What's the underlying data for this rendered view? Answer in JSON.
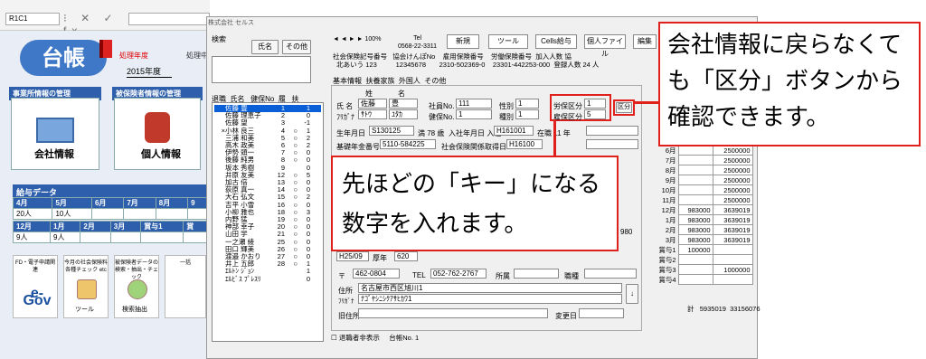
{
  "excel": {
    "cell_ref": "R1C1",
    "formula_symbols": "⁝ ✕ ✓ fx"
  },
  "left_menu": {
    "logo": "台帳",
    "processing_year_label": "処理年度",
    "year_value": "2015年度",
    "right_label": "処理中",
    "section_company": "事業所情報の管理",
    "section_insured": "被保険者情報の管理",
    "company_button": "会社情報",
    "person_button": "個人情報",
    "payroll_title": "給与データ",
    "payroll_row1_headers": [
      "4月",
      "5月",
      "6月",
      "7月",
      "8月",
      "9"
    ],
    "payroll_row1_values": [
      "20人",
      "10人",
      "",
      "",
      "",
      ""
    ],
    "payroll_row2_headers": [
      "12月",
      "1月",
      "2月",
      "3月",
      "賞与1",
      "賞"
    ],
    "payroll_row2_values": [
      "9人",
      "9人",
      "",
      "",
      "",
      ""
    ],
    "tool1_text": "FD・電子申請関連",
    "tool1_logo": "e-Gov",
    "tool2_text": "今月の社会保険料各種チェック etc",
    "tool2_label": "ツール",
    "tool3_text": "被保険者データの検索・抽出・チェック",
    "tool3_label": "検索抽出",
    "tool4_text": "一括"
  },
  "dialog": {
    "title": "株式会社 セルス",
    "search_label": "検索",
    "name_button": "氏名",
    "other_button": "その他",
    "list_header": [
      "退職",
      "氏名",
      "健保No",
      "履",
      "扶"
    ],
    "employees": [
      {
        "mark": "",
        "name": "佐藤 豊",
        "no": "1",
        "r": "",
        "f": "1",
        "sel": true
      },
      {
        "mark": "",
        "name": "佐藤 理恵子",
        "no": "2",
        "r": "",
        "f": "0",
        "sel": false
      },
      {
        "mark": "",
        "name": "佐藤 望",
        "no": "3",
        "r": "",
        "f": "-1",
        "sel": false
      },
      {
        "mark": "×",
        "name": "小林 良三",
        "no": "4",
        "r": "○",
        "f": "1",
        "sel": false
      },
      {
        "mark": "",
        "name": "三浦 和美",
        "no": "5",
        "r": "○",
        "f": "2",
        "sel": false
      },
      {
        "mark": "",
        "name": "高木 政美",
        "no": "6",
        "r": "○",
        "f": "2",
        "sel": false
      },
      {
        "mark": "",
        "name": "伊勢 頭一",
        "no": "7",
        "r": "○",
        "f": "0",
        "sel": false
      },
      {
        "mark": "",
        "name": "後藤 純男",
        "no": "8",
        "r": "○",
        "f": "0",
        "sel": false
      },
      {
        "mark": "",
        "name": "坂本 秀樹",
        "no": "9",
        "r": "",
        "f": "0",
        "sel": false
      },
      {
        "mark": "",
        "name": "井原 友美",
        "no": "12",
        "r": "○",
        "f": "5",
        "sel": false
      },
      {
        "mark": "",
        "name": "加古 倍",
        "no": "13",
        "r": "○",
        "f": "0",
        "sel": false
      },
      {
        "mark": "",
        "name": "荻原 真一",
        "no": "14",
        "r": "○",
        "f": "0",
        "sel": false
      },
      {
        "mark": "",
        "name": "大石 弘文",
        "no": "15",
        "r": "○",
        "f": "2",
        "sel": false
      },
      {
        "mark": "",
        "name": "吉平 小雪",
        "no": "16",
        "r": "○",
        "f": "0",
        "sel": false
      },
      {
        "mark": "",
        "name": "小柳 雅也",
        "no": "18",
        "r": "○",
        "f": "3",
        "sel": false
      },
      {
        "mark": "",
        "name": "内野 猛",
        "no": "19",
        "r": "○",
        "f": "0",
        "sel": false
      },
      {
        "mark": "",
        "name": "神部 幸子",
        "no": "20",
        "r": "○",
        "f": "0",
        "sel": false
      },
      {
        "mark": "",
        "name": "山田 学",
        "no": "21",
        "r": "○",
        "f": "0",
        "sel": false
      },
      {
        "mark": "",
        "name": "一之瀬 綾",
        "no": "25",
        "r": "○",
        "f": "0",
        "sel": false
      },
      {
        "mark": "",
        "name": "田口 輝美",
        "no": "26",
        "r": "○",
        "f": "0",
        "sel": false
      },
      {
        "mark": "",
        "name": "渡邉 かおり",
        "no": "27",
        "r": "○",
        "f": "0",
        "sel": false
      },
      {
        "mark": "",
        "name": "井上 五郎",
        "no": "28",
        "r": "○",
        "f": "1",
        "sel": false
      },
      {
        "mark": "",
        "name": "ｴﾙﾄﾝ ｼﾞｮﾝ",
        "no": "",
        "r": "",
        "f": "1",
        "sel": false
      },
      {
        "mark": "",
        "name": "ｴﾙﾋﾞｽ ﾌﾟﾚｽﾘ",
        "no": "",
        "r": "",
        "f": "0",
        "sel": false
      }
    ],
    "nav_arrows": "◄ ◄ ► ►",
    "zoom": "100%",
    "tel_label": "Tel",
    "tel_value": "0568-22-3311",
    "btn_new": "新規",
    "btn_tool": "ツール",
    "btn_cells": "Cells給与",
    "btn_personal_file": "個人ファイル",
    "btn_edit": "編集",
    "info_labels": [
      "社会保険記号番号",
      "協会けんぽNo",
      "雇用保険番号",
      "労働保険番号",
      "加入人数",
      "協"
    ],
    "info_values": [
      "北あいう 123",
      "12345678",
      "2310-502369-0",
      "23301-442253-000",
      "登録人数 24 人"
    ],
    "tabs": [
      "基本情報",
      "扶養家族",
      "外国人",
      "その他"
    ],
    "furi_header": [
      "姓",
      "名"
    ],
    "name_label": "氏 名",
    "last_name": "佐藤",
    "first_name": "豊",
    "kana_label": "ﾌﾘｶﾞﾅ",
    "last_kana": "ｻﾄｳ",
    "first_kana": "ﾕﾀｶ",
    "emp_no_label": "社員No.",
    "emp_no": "111",
    "health_no_label": "健保No.",
    "health_no": "1",
    "gender_label": "性別",
    "gender": "1",
    "type_label": "種別",
    "type": "1",
    "labor_kubun_label": "労保区分",
    "labor_kubun": "1",
    "emp_kubun_label": "雇保区分",
    "emp_kubun": "5",
    "kubun_button": "区分",
    "birth_label": "生年月日",
    "birth_value": "S130125",
    "age_value": "満 78 歳",
    "join_label": "入社年月日 入社",
    "join_value": "H161001",
    "tenure": "在職 11 年",
    "pension_label": "基礎年金番号",
    "pension_value": "5110-584225",
    "social_rel_label": "社会保険関係",
    "acquire_label": "取得日",
    "acquire_value": "H16100",
    "grade_label": "H25/09",
    "grade_mid": "厚年",
    "grade_val": "620",
    "extra_val": "980",
    "zip_label": "〒",
    "zip_value": "462-0804",
    "tel2_label": "TEL",
    "tel2_value": "052-762-2767",
    "dept_label": "所属",
    "job_label": "職種",
    "address_label": "住所",
    "address_value": "名古屋市西区旭川1",
    "address_kana": "ﾅｺﾞﾔｼﾆｼｸｱｻﾋｶﾜ1",
    "old_address_label": "旧住所",
    "change_date_label": "変更日",
    "retired_check": "退職者非表示",
    "ledger_label": "台帳No.",
    "ledger_value": "1"
  },
  "right_table": {
    "rows": [
      {
        "m": "6月",
        "a": "",
        "b": "2500000"
      },
      {
        "m": "7月",
        "a": "",
        "b": "2500000"
      },
      {
        "m": "8月",
        "a": "",
        "b": "2500000"
      },
      {
        "m": "9月",
        "a": "",
        "b": "2500000"
      },
      {
        "m": "10月",
        "a": "",
        "b": "2500000"
      },
      {
        "m": "11月",
        "a": "",
        "b": "2500000"
      },
      {
        "m": "12月",
        "a": "983000",
        "b": "3639019"
      },
      {
        "m": "1月",
        "a": "983000",
        "b": "3639019"
      },
      {
        "m": "2月",
        "a": "983000",
        "b": "3639019"
      },
      {
        "m": "3月",
        "a": "983000",
        "b": "3639019"
      },
      {
        "m": "賞与1",
        "a": "100000",
        "b": ""
      },
      {
        "m": "賞与2",
        "a": "",
        "b": ""
      },
      {
        "m": "賞与3",
        "a": "",
        "b": "1000000"
      },
      {
        "m": "賞与4",
        "a": "",
        "b": ""
      }
    ],
    "total_label": "計",
    "total_a": "5935019",
    "total_b": "33156076"
  },
  "callouts": {
    "top_right": "会社情報に戻らなくても「区分」ボタンから確認できます。",
    "center": "先ほどの「キー」になる数字を入れます。"
  },
  "colors": {
    "accent_red": "#e0211b",
    "menu_blue": "#2e5fad",
    "selection": "#0a5fd6"
  }
}
